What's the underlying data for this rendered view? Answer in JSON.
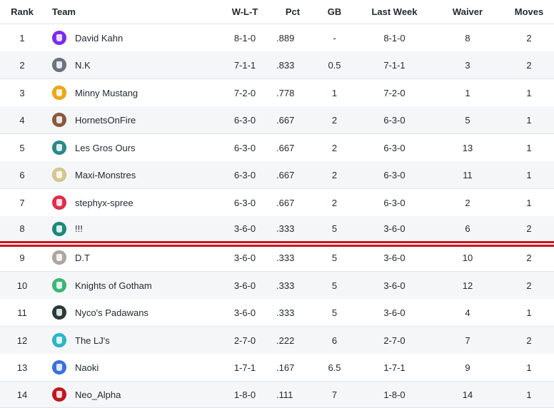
{
  "header": {
    "rank": "Rank",
    "team": "Team",
    "wlt": "W-L-T",
    "pct": "Pct",
    "gb": "GB",
    "last_week": "Last Week",
    "waiver": "Waiver",
    "moves": "Moves"
  },
  "colors": {
    "playoff_line": "#d0121b",
    "row_alt": "#f5f6f7",
    "divider": "#e0e4e9"
  },
  "rows": [
    {
      "rank": "1",
      "team": "David Kahn",
      "wlt": "8-1-0",
      "pct": ".889",
      "gb": "-",
      "last_week": "8-1-0",
      "waiver": "8",
      "moves": "2",
      "logo_color": "#7b2cf0",
      "logo_icon": "jersey-icon"
    },
    {
      "rank": "2",
      "team": "N.K",
      "wlt": "7-1-1",
      "pct": ".833",
      "gb": "0.5",
      "last_week": "7-1-1",
      "waiver": "3",
      "moves": "2",
      "logo_color": "#6b7480",
      "logo_icon": "jersey-icon"
    },
    {
      "rank": "3",
      "team": "Minny Mustang",
      "wlt": "7-2-0",
      "pct": ".778",
      "gb": "1",
      "last_week": "7-2-0",
      "waiver": "1",
      "moves": "1",
      "logo_color": "#f0a818",
      "logo_icon": "jersey-icon"
    },
    {
      "rank": "4",
      "team": "HornetsOnFire",
      "wlt": "6-3-0",
      "pct": ".667",
      "gb": "2",
      "last_week": "6-3-0",
      "waiver": "5",
      "moves": "1",
      "logo_color": "#8a5a3c",
      "logo_icon": "hornet-icon"
    },
    {
      "rank": "5",
      "team": "Les Gros Ours",
      "wlt": "6-3-0",
      "pct": ".667",
      "gb": "2",
      "last_week": "6-3-0",
      "waiver": "13",
      "moves": "1",
      "logo_color": "#2a8a8c",
      "logo_icon": "bear-icon"
    },
    {
      "rank": "6",
      "team": "Maxi-Monstres",
      "wlt": "6-3-0",
      "pct": ".667",
      "gb": "2",
      "last_week": "6-3-0",
      "waiver": "11",
      "moves": "1",
      "logo_color": "#d8c890",
      "logo_icon": "monster-icon"
    },
    {
      "rank": "7",
      "team": "stephyx-spree",
      "wlt": "6-3-0",
      "pct": ".667",
      "gb": "2",
      "last_week": "6-3-0",
      "waiver": "2",
      "moves": "1",
      "logo_color": "#e0304c",
      "logo_icon": "jersey-icon"
    },
    {
      "rank": "8",
      "team": "!!!",
      "wlt": "3-6-0",
      "pct": ".333",
      "gb": "5",
      "last_week": "3-6-0",
      "waiver": "6",
      "moves": "2",
      "logo_color": "#1a8a7c",
      "logo_icon": "jersey-icon"
    },
    {
      "rank": "9",
      "team": "D.T",
      "wlt": "3-6-0",
      "pct": ".333",
      "gb": "5",
      "last_week": "3-6-0",
      "waiver": "10",
      "moves": "2",
      "logo_color": "#b0a8a0",
      "logo_icon": "face-icon"
    },
    {
      "rank": "10",
      "team": "Knights of Gotham",
      "wlt": "3-6-0",
      "pct": ".333",
      "gb": "5",
      "last_week": "3-6-0",
      "waiver": "12",
      "moves": "2",
      "logo_color": "#3cb878",
      "logo_icon": "jersey-icon"
    },
    {
      "rank": "11",
      "team": "Nyco's Padawans",
      "wlt": "3-6-0",
      "pct": ".333",
      "gb": "5",
      "last_week": "3-6-0",
      "waiver": "4",
      "moves": "1",
      "logo_color": "#2a3a3a",
      "logo_icon": "figure-icon"
    },
    {
      "rank": "12",
      "team": "The LJ's",
      "wlt": "2-7-0",
      "pct": ".222",
      "gb": "6",
      "last_week": "2-7-0",
      "waiver": "7",
      "moves": "2",
      "logo_color": "#2ab8c8",
      "logo_icon": "jersey-icon"
    },
    {
      "rank": "13",
      "team": "Naoki",
      "wlt": "1-7-1",
      "pct": ".167",
      "gb": "6.5",
      "last_week": "1-7-1",
      "waiver": "9",
      "moves": "1",
      "logo_color": "#3a70e0",
      "logo_icon": "jersey-icon"
    },
    {
      "rank": "14",
      "team": "Neo_Alpha",
      "wlt": "1-8-0",
      "pct": ".111",
      "gb": "7",
      "last_week": "1-8-0",
      "waiver": "14",
      "moves": "1",
      "logo_color": "#c01820",
      "logo_icon": "flame-icon"
    }
  ]
}
